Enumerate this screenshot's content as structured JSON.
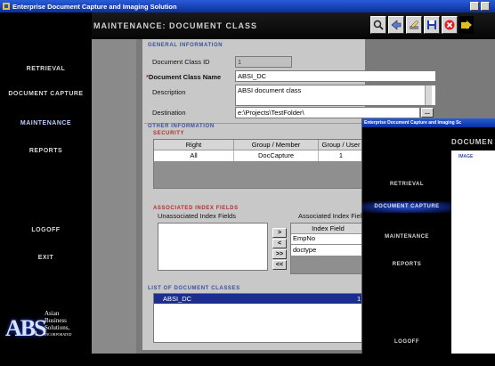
{
  "window": {
    "title": "Enterprise Document Capture and Imaging Solution"
  },
  "header": {
    "title": "Maintenance: Document Class"
  },
  "toolbar": {
    "icons": [
      "search-icon",
      "back-icon",
      "edit-icon",
      "save-icon",
      "delete-icon",
      "exit-icon"
    ]
  },
  "sidebar": {
    "items": [
      {
        "label": "Retrieval"
      },
      {
        "label": "Document Capture"
      },
      {
        "label": "Maintenance",
        "active": true
      },
      {
        "label": "Reports"
      },
      {
        "label": "Logoff"
      },
      {
        "label": "Exit"
      }
    ],
    "logo": {
      "mark": "ABS",
      "line1": "Asian",
      "line2": "Business",
      "line3": "Solutions,",
      "line4": "INCORPORATED"
    }
  },
  "general": {
    "section_title": "General Information",
    "class_id_label": "Document Class ID",
    "class_id_value": "1",
    "name_label": "Document Class Name",
    "name_required_mark": "*",
    "name_value": "ABSI_DC",
    "description_label": "Description",
    "description_value": "ABSI document class",
    "destination_label": "Destination",
    "destination_value": "e:\\Projects\\TestFolder\\",
    "browse_label": "..."
  },
  "other": {
    "section_title": "Other Information",
    "security_title": "Security",
    "columns": [
      "Right",
      "Group / Member",
      "Group / User"
    ],
    "rows": [
      {
        "right": "All",
        "group_member": "DocCapture",
        "group_user": "1"
      }
    ]
  },
  "index_fields": {
    "section_title": "Associated Index Fields",
    "unassociated_label": "Unassociated Index Fields",
    "associated_label": "Associated Index Fiel",
    "associated_column": "Index Field",
    "associated_items": [
      "EmpNo",
      "doctype"
    ],
    "buttons": [
      ">",
      "<",
      ">>",
      "<<"
    ]
  },
  "classes": {
    "section_title": "List of Document Classes",
    "items": [
      {
        "name": "ABSI_DC",
        "id": "1"
      }
    ]
  },
  "second_window": {
    "title": "Enterprise Document Capture and Imaging Sc",
    "header": "Documen",
    "section": "Image",
    "nav": [
      {
        "label": "Retrieval"
      },
      {
        "label": "Document Capture",
        "active": true
      },
      {
        "label": "Maintenance"
      },
      {
        "label": "Reports"
      },
      {
        "label": "Logoff"
      }
    ]
  },
  "colors": {
    "titlebar": "#0a2f9e",
    "section_blue": "#3a4fa0",
    "section_red": "#b0302a",
    "panel": "#c8c8c8",
    "selection": "#1c2f8f"
  }
}
